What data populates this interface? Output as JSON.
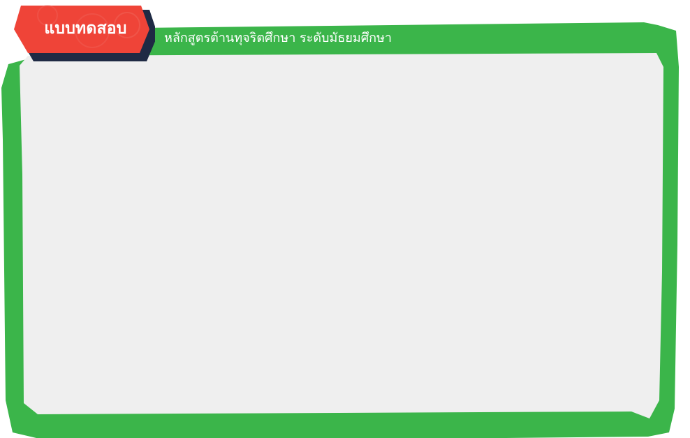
{
  "header": {
    "badge_title": "แบบทดสอบ",
    "subtitle": "หลักสูตรต้านทุจริตศึกษา ระดับมัธยมศึกษา"
  },
  "colors": {
    "frame_green": "#3bb54a",
    "panel_gray": "#efefef",
    "badge_red": "#ef4438",
    "badge_shadow": "#1f2a44",
    "text_white": "#ffffff"
  }
}
